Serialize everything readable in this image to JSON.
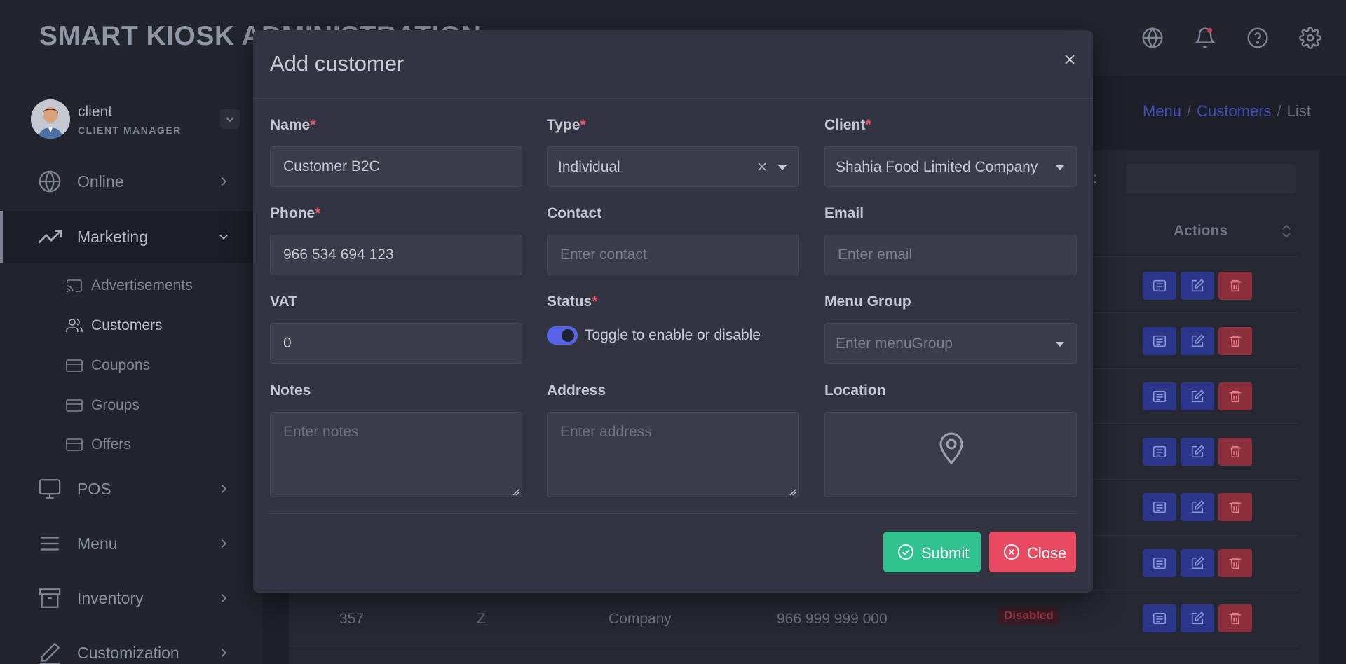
{
  "app": {
    "title": "SMART KIOSK ADMINISTRATION"
  },
  "header": {
    "icons": [
      "globe-icon",
      "bell-icon",
      "help-icon",
      "gear-icon"
    ]
  },
  "profile": {
    "name": "client",
    "role": "CLIENT MANAGER"
  },
  "sidebar": {
    "items": [
      {
        "label": "Online",
        "icon": "globe-icon"
      },
      {
        "label": "Marketing",
        "icon": "trending-up-icon"
      },
      {
        "label": "POS",
        "icon": "monitor-icon"
      },
      {
        "label": "Menu",
        "icon": "menu-icon"
      },
      {
        "label": "Inventory",
        "icon": "archive-icon"
      },
      {
        "label": "Customization",
        "icon": "pen-icon"
      }
    ],
    "marketing_sub": [
      {
        "label": "Advertisements",
        "icon": "cast-icon"
      },
      {
        "label": "Customers",
        "icon": "users-icon"
      },
      {
        "label": "Coupons",
        "icon": "card-icon"
      },
      {
        "label": "Groups",
        "icon": "card-icon"
      },
      {
        "label": "Offers",
        "icon": "card-icon"
      }
    ]
  },
  "breadcrumb": {
    "items": [
      "Menu",
      "Customers",
      "List"
    ],
    "separator": "/"
  },
  "list": {
    "search_label": "rch:",
    "column_actions": "Actions",
    "visible_row": {
      "id": "357",
      "name": "Z",
      "type": "Company",
      "phone": "966 999 999 000",
      "status": "Disabled"
    }
  },
  "modal": {
    "title": "Add customer",
    "fields": {
      "name": {
        "label": "Name",
        "required_mark": "*",
        "value": "Customer B2C"
      },
      "type": {
        "label": "Type",
        "required_mark": "*",
        "value": "Individual"
      },
      "client": {
        "label": "Client",
        "required_mark": "*",
        "value": "Shahia Food Limited Company"
      },
      "phone": {
        "label": "Phone",
        "required_mark": "*",
        "value": "966 534 694 123"
      },
      "contact": {
        "label": "Contact",
        "placeholder": "Enter contact"
      },
      "email": {
        "label": "Email",
        "placeholder": "Enter email"
      },
      "vat": {
        "label": "VAT",
        "value": "0"
      },
      "status": {
        "label": "Status",
        "required_mark": "*",
        "toggle_label": "Toggle to enable or disable",
        "enabled": true
      },
      "menu_group": {
        "label": "Menu Group",
        "placeholder": "Enter menuGroup"
      },
      "notes": {
        "label": "Notes",
        "placeholder": "Enter notes"
      },
      "address": {
        "label": "Address",
        "placeholder": "Enter address"
      },
      "location": {
        "label": "Location",
        "icon": "map-pin-icon"
      }
    },
    "buttons": {
      "submit": "Submit",
      "close": "Close"
    }
  },
  "colors": {
    "submit": "#2fc28e",
    "close": "#e84a62",
    "toggle_on": "#5864e6",
    "required": "#e4566a",
    "link": "#3f4fb8"
  }
}
